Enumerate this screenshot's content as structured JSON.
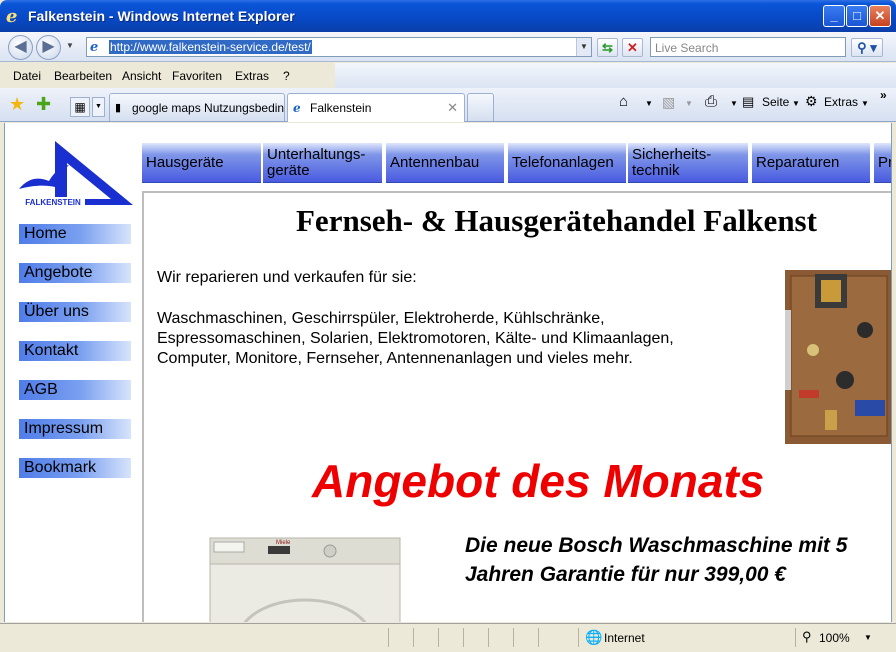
{
  "window": {
    "title": "Falkenstein - Windows Internet Explorer"
  },
  "address": {
    "url": "http://www.falkenstein-service.de/test/",
    "search_placeholder": "Live Search"
  },
  "menu": [
    "Datei",
    "Bearbeiten",
    "Ansicht",
    "Favoriten",
    "Extras",
    "?"
  ],
  "tabs": [
    {
      "label": "google maps Nutzungsbeding…"
    },
    {
      "label": "Falkenstein"
    }
  ],
  "commands": {
    "page": "Seite",
    "tools": "Extras"
  },
  "page": {
    "logo_text": "FALKENSTEIN",
    "sidebar": [
      "Home",
      "Angebote",
      "Über uns",
      "Kontakt",
      "AGB",
      "Impressum",
      "Bookmark"
    ],
    "topnav": [
      {
        "line1": "Hausgeräte",
        "line2": ""
      },
      {
        "line1": "Unterhaltungs-",
        "line2": "geräte"
      },
      {
        "line1": "Antennenbau",
        "line2": ""
      },
      {
        "line1": "Telefonanlagen",
        "line2": ""
      },
      {
        "line1": "Sicherheits-",
        "line2": "technik"
      },
      {
        "line1": "Reparaturen",
        "line2": ""
      },
      {
        "line1": "Pr",
        "line2": ""
      }
    ],
    "heading": "Fernseh- & Hausgerätehandel Falkenst",
    "intro": "Wir reparieren und verkaufen für sie:",
    "services": [
      "Waschmaschinen, Geschirrspüler, Elektroherde, Kühlschränke,",
      "Espressomaschinen, Solarien, Elektromotoren, Kälte- und Klimaanlagen,",
      "Computer, Monitore, Fernseher, Antennenanlagen und vieles mehr."
    ],
    "offer_title": "Angebot des Monats",
    "offer_line1": "Die neue Bosch Waschmaschine mit 5",
    "offer_line2": "Jahren Garantie für nur 399,00 €",
    "washer_brand": "Miele"
  },
  "status": {
    "zone": "Internet",
    "zoom": "100%"
  }
}
